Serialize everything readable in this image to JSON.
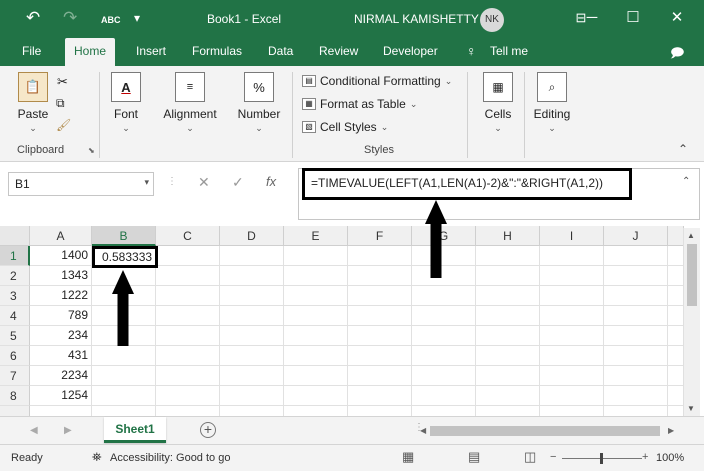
{
  "window": {
    "title": "Book1  -  Excel",
    "user_name": "NIRMAL KAMISHETTY",
    "user_initials": "NK",
    "autosave_badge": "ABC"
  },
  "tabs": [
    "File",
    "Home",
    "Insert",
    "Formulas",
    "Data",
    "Review",
    "Developer",
    "Tell me"
  ],
  "active_tab": "Home",
  "ribbon": {
    "clipboard": {
      "paste": "Paste",
      "group": "Clipboard"
    },
    "font": "Font",
    "alignment": "Alignment",
    "number": {
      "label": "Number",
      "icon_text": "%"
    },
    "font_icon_text": "A",
    "styles": {
      "conditional": "Conditional Formatting",
      "format_table": "Format as Table",
      "cell_styles": "Cell Styles",
      "group": "Styles"
    },
    "cells": "Cells",
    "editing": "Editing"
  },
  "formula_bar": {
    "name_box": "B1",
    "formula": "=TIMEVALUE(LEFT(A1,LEN(A1)-2)&\":\"&RIGHT(A1,2))",
    "fx": "fx"
  },
  "grid": {
    "columns": [
      "A",
      "B",
      "C",
      "D",
      "E",
      "F",
      "G",
      "H",
      "I",
      "J"
    ],
    "rows": [
      "1",
      "2",
      "3",
      "4",
      "5",
      "6",
      "7",
      "8"
    ],
    "column_a_values": [
      "1400",
      "1343",
      "1222",
      "789",
      "234",
      "431",
      "2234",
      "1254"
    ],
    "active_cell_value": "0.583333"
  },
  "sheets": {
    "tab": "Sheet1",
    "add": "+"
  },
  "status": {
    "ready": "Ready",
    "accessibility": "Accessibility: Good to go",
    "zoom": "100%"
  },
  "colors": {
    "brand": "#217346",
    "annotation": "#000000"
  }
}
